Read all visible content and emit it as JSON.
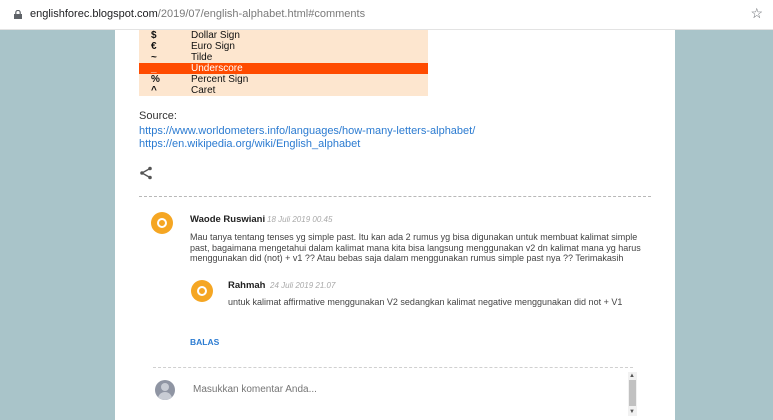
{
  "browser": {
    "url_domain": "englishforec.blogspot.com",
    "url_path": "/2019/07/english-alphabet.html#comments"
  },
  "symbols": [
    {
      "sym": "$",
      "name": "Dollar Sign",
      "highlight": false
    },
    {
      "sym": "€",
      "name": "Euro Sign",
      "highlight": false
    },
    {
      "sym": "~",
      "name": "Tilde",
      "highlight": false
    },
    {
      "sym": "_",
      "name": "Underscore",
      "highlight": true
    },
    {
      "sym": "%",
      "name": "Percent Sign",
      "highlight": false
    },
    {
      "sym": "^",
      "name": "Caret",
      "highlight": false
    }
  ],
  "source": {
    "label": "Source:",
    "links": [
      "https://www.worldometers.info/languages/how-many-letters-alphabet/",
      "https://en.wikipedia.org/wiki/English_alphabet"
    ]
  },
  "comments": [
    {
      "author": "Waode Ruswiani",
      "date": "18 Juli 2019 00.45",
      "text": "Mau tanya tentang tenses yg simple past. Itu kan ada 2 rumus yg bisa digunakan untuk membuat kalimat simple past, bagaimana mengetahui dalam kalimat mana kita bisa langsung menggunakan v2 dn kalimat mana yg harus menggunakan did (not) + v1 ?? Atau bebas saja dalam menggunakan rumus simple past nya ?? Terimakasih"
    },
    {
      "author": "Rahmah",
      "date": "24 Juli 2019 21.07",
      "text": "untuk kalimat affirmative menggunakan V2 sedangkan kalimat negative menggunakan did not + V1"
    }
  ],
  "reply_label": "BALAS",
  "comment_box": {
    "placeholder": "Masukkan komentar Anda..."
  },
  "colors": {
    "table_row": "#fde6cf",
    "highlight": "#ff4b00",
    "link": "#2b7bd1",
    "avatar": "#f5a623"
  }
}
